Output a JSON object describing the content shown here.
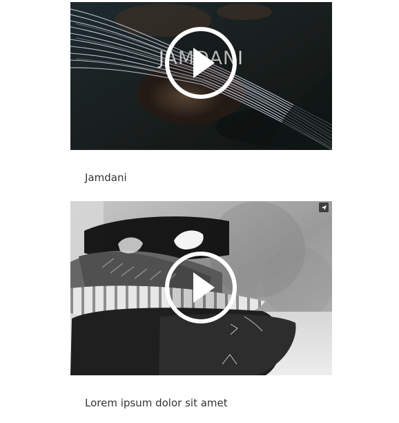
{
  "videos": [
    {
      "overlay_title": "JAMDANI",
      "caption": "Jamdani",
      "play_icon": "play-icon"
    },
    {
      "caption": "Lorem ipsum dolor sit amet",
      "play_icon": "play-icon",
      "share_icon": "share-icon"
    }
  ],
  "colors": {
    "background": "#ffffff",
    "caption_text": "#333333",
    "play_ring": "#ffffff"
  }
}
